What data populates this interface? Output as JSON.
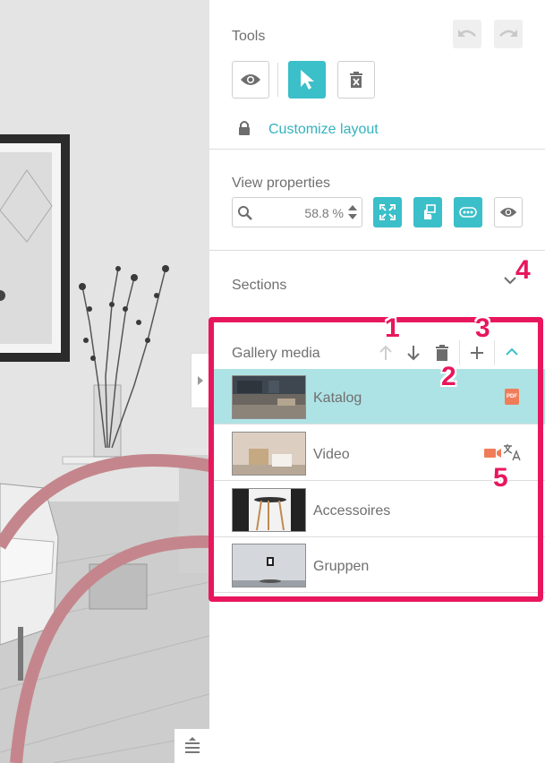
{
  "tools": {
    "title": "Tools",
    "customize_link": "Customize layout"
  },
  "view_properties": {
    "title": "View properties",
    "zoom_value": "58.8 %"
  },
  "sections": {
    "title": "Sections"
  },
  "gallery": {
    "title": "Gallery media",
    "items": [
      {
        "label": "Katalog",
        "badge": "PDF",
        "selected": true
      },
      {
        "label": "Video",
        "selected": false
      },
      {
        "label": "Accessoires",
        "selected": false
      },
      {
        "label": "Gruppen",
        "selected": false
      }
    ]
  },
  "annotations": [
    "1",
    "2",
    "3",
    "4",
    "5"
  ],
  "colors": {
    "accent": "#3bbfc9",
    "annotation": "#e8175d",
    "selected_row": "#aee3e5",
    "badge": "#f07d5a"
  },
  "icons": {
    "undo": "undo-icon",
    "redo": "redo-icon",
    "preview": "eye-icon",
    "select": "cursor-icon",
    "delete": "trash-icon",
    "lock": "lock-icon",
    "search": "search-icon",
    "fullscreen": "expand-icon",
    "touch": "touch-icon",
    "more": "more-icon",
    "up": "arrow-up-icon",
    "down": "arrow-down-icon",
    "add": "plus-icon",
    "collapse": "chevron-up-icon",
    "expand": "chevron-down-icon",
    "video": "video-camera-icon",
    "translate": "translate-icon"
  }
}
